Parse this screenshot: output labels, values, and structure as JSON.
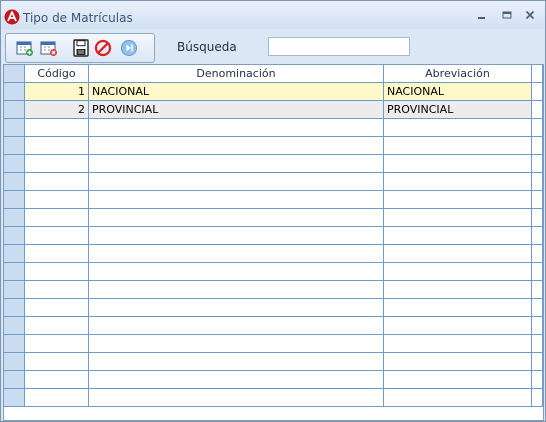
{
  "window": {
    "title": "Tipo de Matrículas",
    "minimize_icon": "minimize-icon",
    "maximize_icon": "maximize-icon",
    "close_icon": "close-icon"
  },
  "toolbar": {
    "buttons": [
      {
        "name": "new-record-button",
        "icon": "calendar-add-icon"
      },
      {
        "name": "delete-record-button",
        "icon": "calendar-delete-icon"
      },
      {
        "name": "save-button",
        "icon": "save-icon"
      },
      {
        "name": "cancel-button",
        "icon": "cancel-icon"
      },
      {
        "name": "exit-button",
        "icon": "exit-icon"
      }
    ]
  },
  "search": {
    "label": "Búsqueda",
    "value": ""
  },
  "grid": {
    "columns": [
      "Código",
      "Denominación",
      "Abreviación"
    ],
    "rows": [
      {
        "codigo": "1",
        "denominacion": "NACIONAL",
        "abreviacion": "NACIONAL",
        "state": "selected"
      },
      {
        "codigo": "2",
        "denominacion": "PROVINCIAL",
        "abreviacion": "PROVINCIAL",
        "state": "alternate"
      }
    ],
    "empty_row_count": 16
  },
  "colors": {
    "selected_row": "#fff8c8",
    "alternate_row": "#ececec",
    "grid_lines": "#6f9bc9",
    "indicator": "#c9dcf1"
  }
}
